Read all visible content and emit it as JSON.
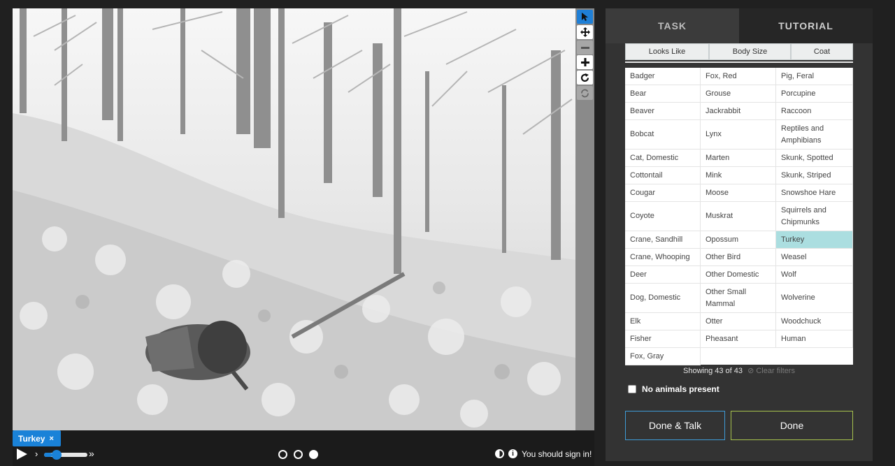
{
  "viewer": {
    "image_alt": "Infrared trail camera photo of a turkey in a forest"
  },
  "toolbar": {
    "tools": [
      {
        "name": "select-icon"
      },
      {
        "name": "move-icon"
      },
      {
        "name": "zoom-out-icon"
      },
      {
        "name": "zoom-in-icon"
      },
      {
        "name": "rotate-icon"
      },
      {
        "name": "reset-icon"
      }
    ]
  },
  "annotation_chip": {
    "label": "Turkey",
    "remove": "×"
  },
  "player": {
    "speed_slow": "›",
    "speed_fast": "»",
    "speed_level": 0.2,
    "current_frame": 3,
    "frame_count": 3
  },
  "status": {
    "sign_in": "You should sign in!"
  },
  "tabs": {
    "task": "TASK",
    "tutorial": "TUTORIAL"
  },
  "filters": {
    "looks_like": "Looks Like",
    "body_size": "Body Size",
    "coat": "Coat"
  },
  "choices": [
    "Badger",
    "Fox, Red",
    "Pig, Feral",
    "Bear",
    "Grouse",
    "Porcupine",
    "Beaver",
    "Jackrabbit",
    "Raccoon",
    "Bobcat",
    "Lynx",
    "Reptiles and Amphibians",
    "Cat, Domestic",
    "Marten",
    "Skunk, Spotted",
    "Cottontail",
    "Mink",
    "Skunk, Striped",
    "Cougar",
    "Moose",
    "Snowshoe Hare",
    "Coyote",
    "Muskrat",
    "Squirrels and Chipmunks",
    "Crane, Sandhill",
    "Opossum",
    "Turkey",
    "Crane, Whooping",
    "Other Bird",
    "Weasel",
    "Deer",
    "Other Domestic",
    "Wolf",
    "Dog, Domestic",
    "Other Small Mammal",
    "Wolverine",
    "Elk",
    "Otter",
    "Woodchuck",
    "Fisher",
    "Pheasant",
    "Human",
    "Fox, Gray",
    "",
    ""
  ],
  "selected_choice": "Turkey",
  "showing": {
    "text": "Showing 43 of 43",
    "clear": "⊘ Clear filters"
  },
  "no_animals": "No animals present",
  "buttons": {
    "done_talk": "Done & Talk",
    "done": "Done"
  }
}
